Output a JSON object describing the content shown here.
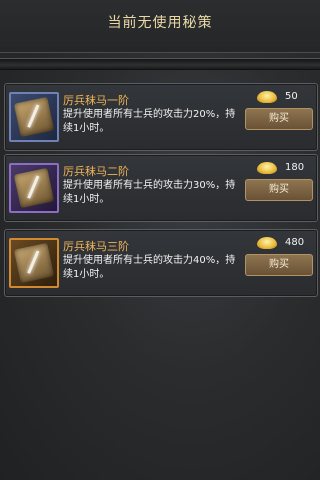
{
  "header": {
    "title": "当前无使用秘策"
  },
  "items": [
    {
      "name": "厉兵秣马一阶",
      "description": "提升使用者所有士兵的攻击力20%，持续1小时。",
      "price": "50",
      "buy_label": "购买",
      "icon": "scroll-icon",
      "rarity_color": "#6f82b6"
    },
    {
      "name": "厉兵秣马二阶",
      "description": "提升使用者所有士兵的攻击力30%，持续1小时。",
      "price": "180",
      "buy_label": "购买",
      "icon": "scroll-icon",
      "rarity_color": "#8c6cc4"
    },
    {
      "name": "厉兵秣马三阶",
      "description": "提升使用者所有士兵的攻击力40%，持续1小时。",
      "price": "480",
      "buy_label": "购买",
      "icon": "scroll-icon",
      "rarity_color": "#d28a2e"
    }
  ],
  "currency_icon": "gold-ingot-icon"
}
